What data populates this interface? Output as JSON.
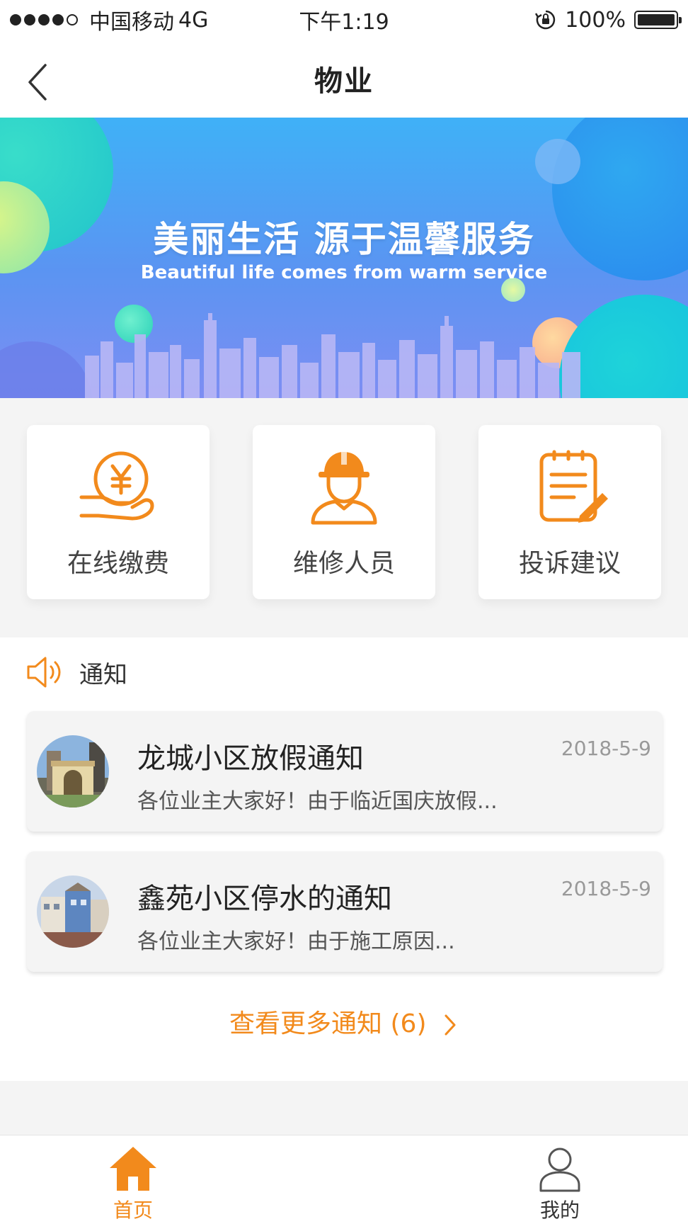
{
  "status_bar": {
    "carrier": "中国移动",
    "network": "4G",
    "time": "下午1:19",
    "battery": "100%",
    "icons": [
      "signal-dots-icon",
      "rotation-lock-icon",
      "battery-icon"
    ]
  },
  "nav": {
    "title": "物业",
    "back_icon": "back-chevron-icon"
  },
  "banner": {
    "title": "美丽生活  源于温馨服务",
    "subtitle": "Beautiful life comes from warm service"
  },
  "actions": [
    {
      "label": "在线缴费",
      "icon": "yen-hand-icon"
    },
    {
      "label": "维修人员",
      "icon": "worker-helmet-icon"
    },
    {
      "label": "投诉建议",
      "icon": "notepad-pen-icon"
    }
  ],
  "notices": {
    "header": "通知",
    "header_icon": "speaker-icon",
    "items": [
      {
        "title": "龙城小区放假通知",
        "date": "2018-5-9",
        "body": "各位业主大家好！由于临近国庆放假..."
      },
      {
        "title": "鑫苑小区停水的通知",
        "date": "2018-5-9",
        "body": "各位业主大家好！由于施工原因..."
      }
    ],
    "more": "查看更多通知 (6)"
  },
  "tabs": [
    {
      "label": "首页",
      "icon": "home-icon",
      "active": true
    },
    {
      "label": "我的",
      "icon": "user-icon",
      "active": false
    }
  ],
  "colors": {
    "accent": "#f28a1c",
    "banner_top": "#3fb1f7",
    "banner_bottom": "#7d8ef3"
  }
}
